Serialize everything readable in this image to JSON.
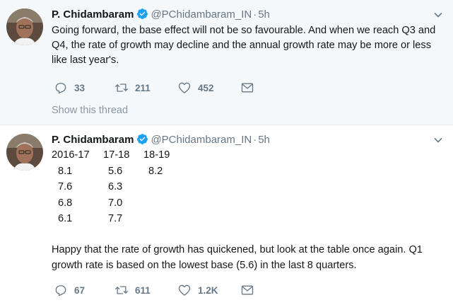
{
  "colors": {
    "verified": "#1da1f2",
    "muted": "#657786",
    "thread_link": "#8899a6",
    "text": "#14171a",
    "tweet1_bg": "#f5f8fa"
  },
  "tweets": [
    {
      "name": "P. Chidambaram",
      "handle": "@PChidambaram_IN",
      "separator": "·",
      "time": "5h",
      "text": "Going forward, the base effect will not be so favourable. And when we reach Q3 and Q4, the rate of growth may decline and the annual growth rate may be more or less like last year's.",
      "replies": "33",
      "retweets": "211",
      "likes": "452",
      "show_thread": "Show this thread",
      "icons": {
        "verified": "verified-badge-icon",
        "caret": "chevron-down-icon",
        "reply": "reply-icon",
        "retweet": "retweet-icon",
        "like": "heart-icon",
        "dm": "envelope-icon"
      }
    },
    {
      "name": "P. Chidambaram",
      "handle": "@PChidambaram_IN",
      "separator": "·",
      "time": "5h",
      "table": {
        "headers": [
          "2016-17",
          "17-18",
          "18-19"
        ],
        "rows": [
          [
            "8.1",
            "5.6",
            "8.2"
          ],
          [
            "7.6",
            "6.3",
            ""
          ],
          [
            "6.8",
            "7.0",
            ""
          ],
          [
            "6.1",
            "7.7",
            ""
          ]
        ]
      },
      "caption": "Happy that the rate of growth has quickened, but look at the table once again. Q1 growth rate is based on the lowest base (5.6) in the last 8 quarters.",
      "replies": "67",
      "retweets": "611",
      "likes": "1.2K"
    }
  ]
}
